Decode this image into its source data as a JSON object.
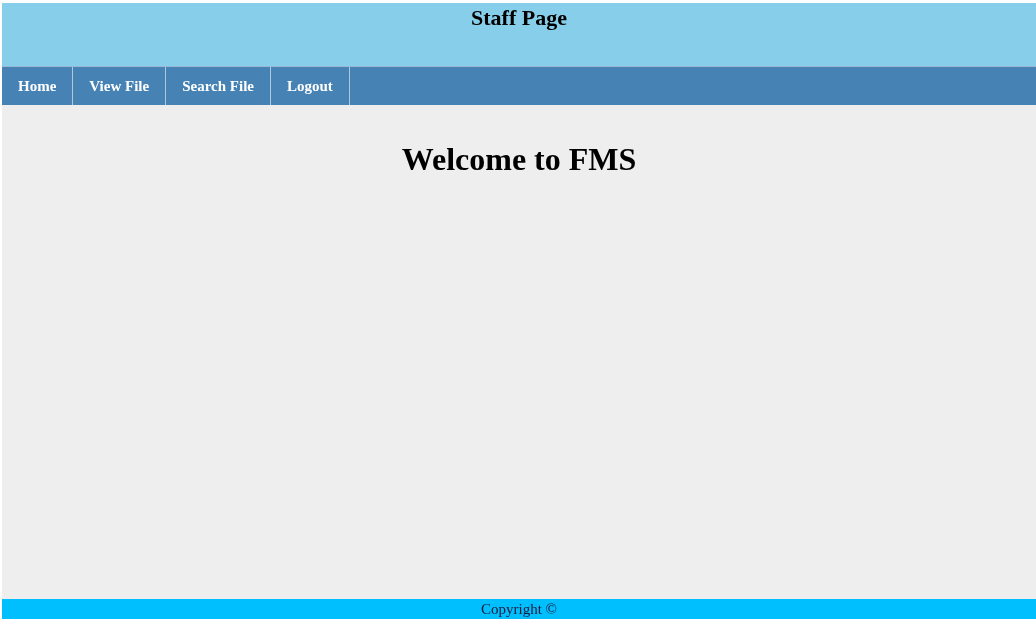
{
  "header": {
    "title": "Staff Page"
  },
  "nav": [
    {
      "label": "Home"
    },
    {
      "label": "View File"
    },
    {
      "label": "Search File"
    },
    {
      "label": "Logout"
    }
  ],
  "main": {
    "heading": "Welcome to FMS"
  },
  "footer": {
    "text": "Copyright ©"
  }
}
